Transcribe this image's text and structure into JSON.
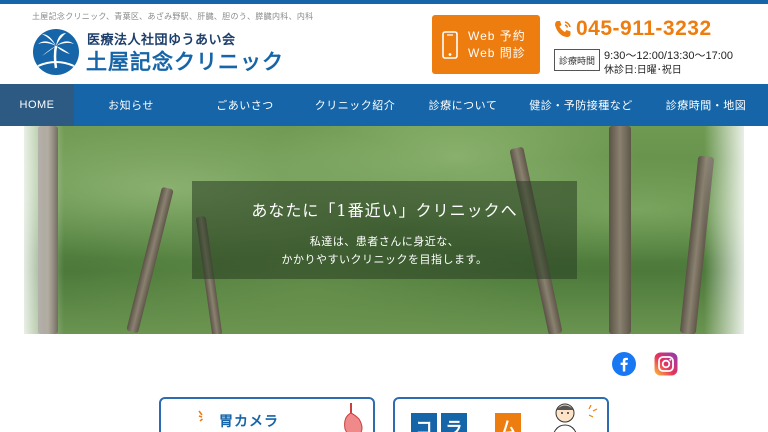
{
  "header": {
    "tagline": "土屋記念クリニック、青葉区、あざみ野駅、肝臓、胆のう、膵臓内科、内科",
    "org_name": "医療法人社団ゆうあい会",
    "clinic_name": "土屋記念クリニック",
    "web_button": {
      "line1": "Web 予約",
      "line2": "Web 問診"
    },
    "phone": "045-911-3232",
    "hours_label": "診療時間",
    "hours": "9:30〜12:00/13:30〜17:00",
    "closed_days": "休診日:日曜･祝日"
  },
  "nav": {
    "items": [
      {
        "label": "HOME",
        "active": true
      },
      {
        "label": "お知らせ",
        "active": false
      },
      {
        "label": "ごあいさつ",
        "active": false
      },
      {
        "label": "クリニック紹介",
        "active": false
      },
      {
        "label": "診療について",
        "active": false
      },
      {
        "label": "健診・予防接種など",
        "active": false
      },
      {
        "label": "診療時間・地図",
        "active": false
      }
    ]
  },
  "hero": {
    "title": "あなたに「1番近い」クリニックへ",
    "subtitle_line1": "私達は、患者さんに身近な、",
    "subtitle_line2": "かかりやすいクリニックを目指します。"
  },
  "social": {
    "facebook": "facebook-icon",
    "instagram": "instagram-icon"
  },
  "cards": {
    "gastro_camera": {
      "label": "胃カメラ"
    },
    "column": {
      "tiles": [
        "コ",
        "ラ",
        "ム"
      ]
    }
  },
  "colors": {
    "brand_blue": "#1565a8",
    "accent_orange": "#ee7d10",
    "nav_active": "#2c5a82"
  }
}
